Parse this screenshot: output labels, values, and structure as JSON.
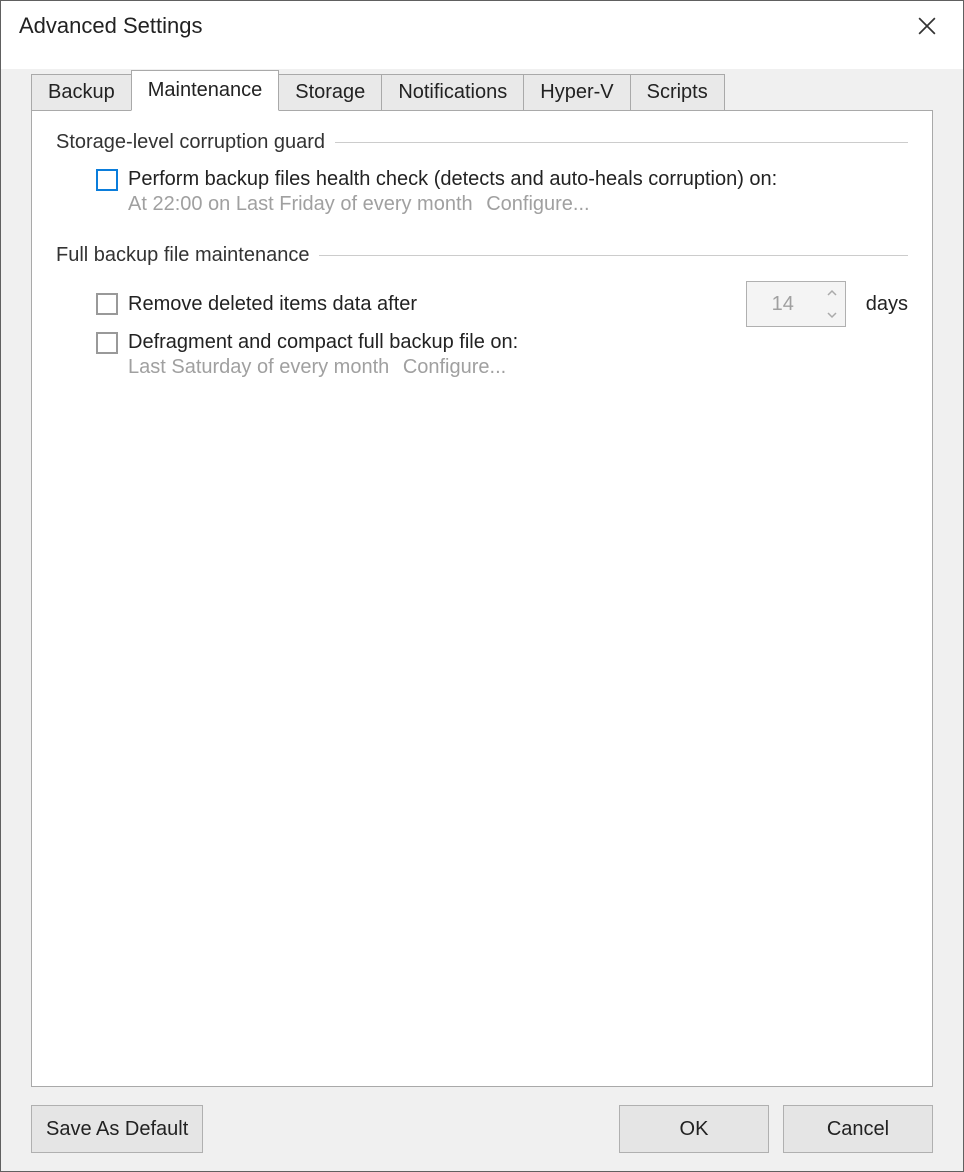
{
  "dialog": {
    "title": "Advanced Settings"
  },
  "tabs": {
    "backup": "Backup",
    "maintenance": "Maintenance",
    "storage": "Storage",
    "notifications": "Notifications",
    "hyperv": "Hyper-V",
    "scripts": "Scripts",
    "active": "maintenance"
  },
  "groups": {
    "corruption_guard": {
      "title": "Storage-level corruption guard",
      "health_check_label": "Perform backup files health check (detects and auto-heals corruption) on:",
      "health_check_checked": false,
      "schedule_text": "At 22:00 on Last Friday of every month",
      "configure_label": "Configure..."
    },
    "full_backup": {
      "title": "Full backup file maintenance",
      "remove_deleted_label": "Remove deleted items data after",
      "remove_deleted_checked": false,
      "remove_deleted_value": "14",
      "remove_deleted_unit": "days",
      "defrag_label": "Defragment and compact full backup file on:",
      "defrag_checked": false,
      "defrag_schedule": "Last Saturday of every month",
      "configure_label": "Configure..."
    }
  },
  "footer": {
    "save_default": "Save As Default",
    "ok": "OK",
    "cancel": "Cancel"
  }
}
